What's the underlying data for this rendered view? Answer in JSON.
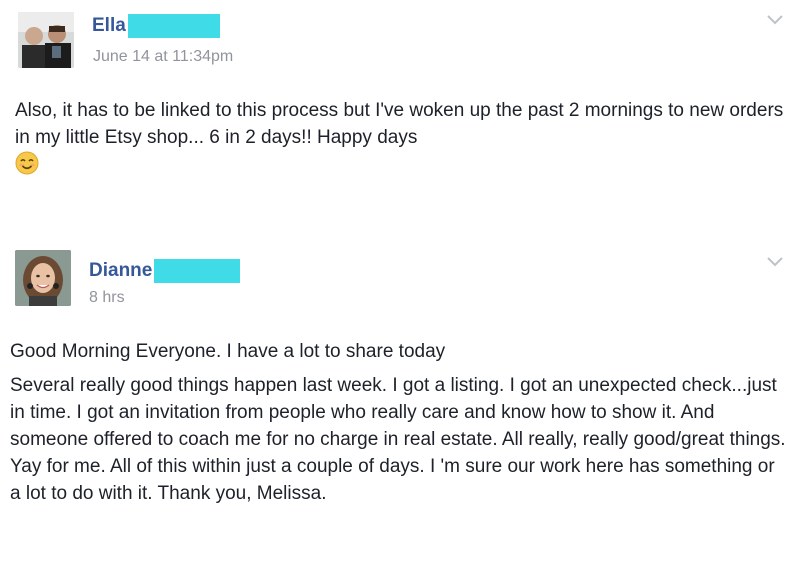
{
  "post1": {
    "author": "Ella",
    "timestamp": "June 14 at 11:34pm",
    "text": "Also, it has to be linked to this process but I've woken up the past 2 mornings to new orders in my little Etsy shop... 6 in 2 days!! Happy days",
    "emoji": "smiling-face-emoji",
    "menu_icon": "chevron-down-icon"
  },
  "post2": {
    "author": "Dianne",
    "timestamp": "8 hrs",
    "paragraph1": "Good Morning Everyone. I have a lot to share today",
    "paragraph2": "Several really good things happen last week. I got a listing. I got an unexpected check...just in time. I got an invitation from people who really care and know how to show it. And someone offered to coach me for no charge in real estate. All really, really good/great things. Yay for me. All of this within just a couple of days. I 'm sure our work here has something or a lot to do with it. Thank you, Melissa.",
    "menu_icon": "chevron-down-icon"
  },
  "colors": {
    "author_link": "#365899",
    "redaction": "#3fdce8",
    "meta_text": "#90949c",
    "body_text": "#1d2129"
  }
}
